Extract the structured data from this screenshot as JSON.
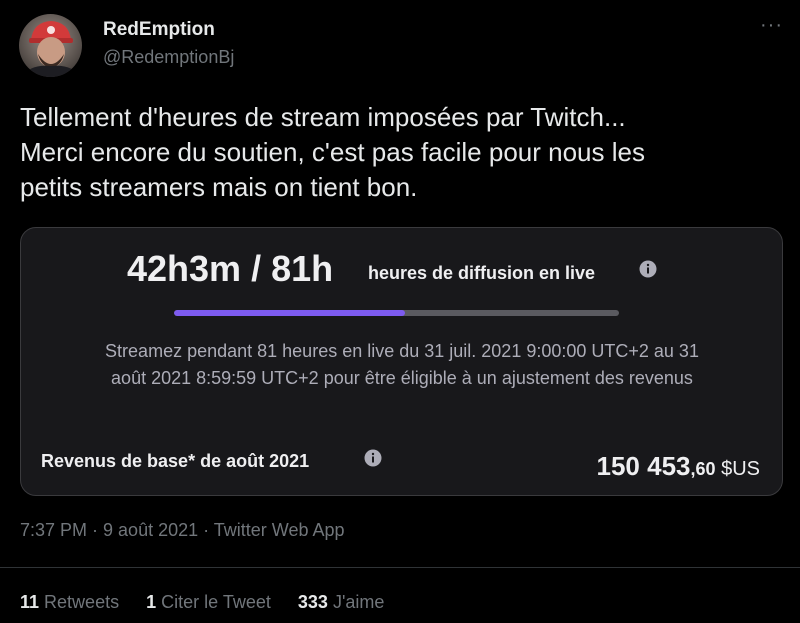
{
  "author": {
    "display_name": "RedEmption",
    "handle": "@RedemptionBj"
  },
  "menu_icon": "more-horizontal-icon",
  "tweet_text": {
    "line1": "Tellement d'heures de stream imposées par Twitch...",
    "line2": "Merci encore du soutien, c'est pas facile pour nous les",
    "line3": "petits streamers mais on tient bon."
  },
  "card": {
    "hours_progress": "42h3m / 81h",
    "hours_label": "heures de diffusion en live",
    "progress_fraction": 0.52,
    "description_line1": "Streamez pendant 81 heures en live du 31 juil. 2021 9:00:00 UTC+2 au 31",
    "description_line2": "août 2021 8:59:59 UTC+2 pour être éligible à un ajustement des revenus",
    "revenue_label": "Revenus de base* de août 2021",
    "revenue_integer": "150 453",
    "revenue_decimal": ",60",
    "revenue_currency": " $US",
    "info_icon": "info-icon",
    "accent_color": "#7d5bf0"
  },
  "meta": "7:37 PM · 9 août 2021 · Twitter Web App",
  "stats": {
    "retweets_count": "11",
    "retweets_label": "Retweets",
    "quotes_count": "1",
    "quotes_label": "Citer le Tweet",
    "likes_count": "333",
    "likes_label": "J'aime"
  }
}
